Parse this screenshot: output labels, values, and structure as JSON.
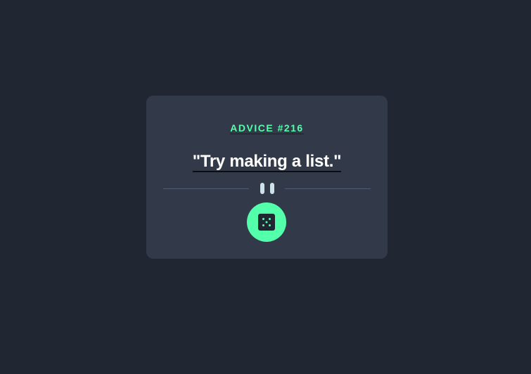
{
  "card": {
    "advice_label": "ADVICE #216",
    "advice_text": "\"Try making a list.\""
  },
  "colors": {
    "background": "#202632",
    "card": "#323a49",
    "accent": "#53ffaa",
    "text": "#ffffff",
    "divider_line": "#4f5d74",
    "pause_bars": "#cee3e9"
  },
  "icons": {
    "divider": "pause-icon",
    "button": "dice-icon"
  }
}
